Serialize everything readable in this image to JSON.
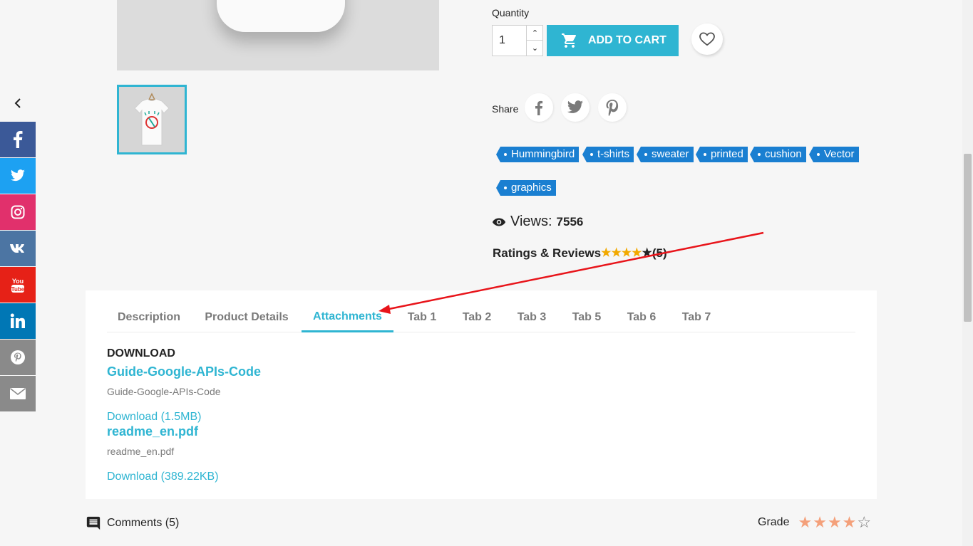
{
  "purchase": {
    "quantity_label": "Quantity",
    "quantity_value": "1",
    "add_to_cart_label": "ADD TO CART"
  },
  "share": {
    "label": "Share",
    "icons": [
      "facebook-icon",
      "twitter-icon",
      "pinterest-icon"
    ]
  },
  "tags": [
    "Hummingbird",
    "t-shirts",
    "sweater",
    "printed",
    "cushion",
    "Vector",
    "graphics"
  ],
  "views": {
    "label": "Views:",
    "count": "7556"
  },
  "ratings": {
    "label": "Ratings & Reviews",
    "stars_filled": 4,
    "stars_total": 5,
    "count_text": "(5)"
  },
  "social_sidebar": [
    {
      "name": "facebook",
      "color": "#3b5998"
    },
    {
      "name": "twitter",
      "color": "#1da1f2"
    },
    {
      "name": "instagram",
      "color": "#e1306c"
    },
    {
      "name": "vk",
      "color": "#4c75a3"
    },
    {
      "name": "youtube",
      "color": "#e62117"
    },
    {
      "name": "linkedin",
      "color": "#0077b5"
    },
    {
      "name": "pinterest",
      "color": "#8a8a8a"
    },
    {
      "name": "email",
      "color": "#8a8a8a"
    }
  ],
  "tabs": [
    {
      "label": "Description",
      "active": false
    },
    {
      "label": "Product Details",
      "active": false
    },
    {
      "label": "Attachments",
      "active": true
    },
    {
      "label": "Tab 1",
      "active": false
    },
    {
      "label": "Tab 2",
      "active": false
    },
    {
      "label": "Tab 3",
      "active": false
    },
    {
      "label": "Tab 5",
      "active": false
    },
    {
      "label": "Tab 6",
      "active": false
    },
    {
      "label": "Tab 7",
      "active": false
    }
  ],
  "attachments": {
    "heading": "DOWNLOAD",
    "items": [
      {
        "title": "Guide-Google-APIs-Code",
        "description": "Guide-Google-APIs-Code",
        "link": "Download (1.5MB)"
      },
      {
        "title": "readme_en.pdf",
        "description": "readme_en.pdf",
        "link": "Download (389.22KB)"
      }
    ]
  },
  "comments": {
    "label": "Comments (5)"
  },
  "grade": {
    "label": "Grade",
    "stars_filled": 4,
    "stars_total": 5
  },
  "colors": {
    "accent": "#2fb5d2",
    "tag_blue": "#1a7fd1",
    "star_gold": "#f2a900",
    "annotation_red": "#e8141a"
  }
}
